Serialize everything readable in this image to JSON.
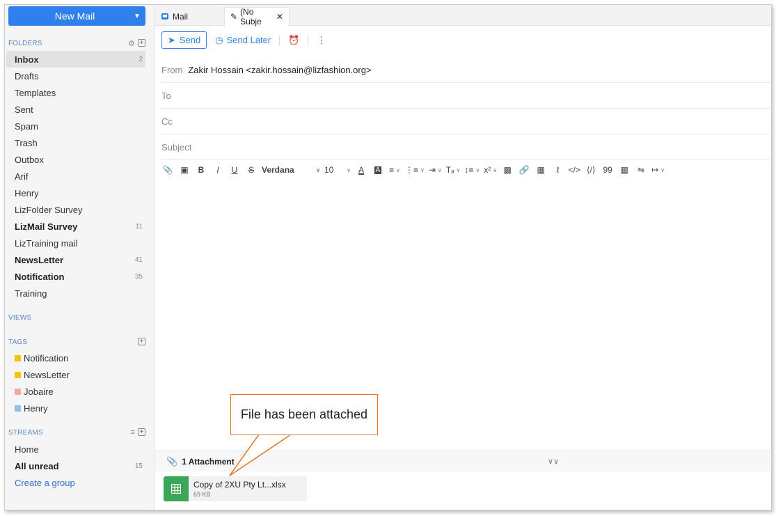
{
  "sidebar": {
    "new_mail_label": "New Mail",
    "folders_heading": "FOLDERS",
    "folders": [
      {
        "label": "Inbox",
        "count": "2"
      },
      {
        "label": "Drafts",
        "count": ""
      },
      {
        "label": "Templates",
        "count": ""
      },
      {
        "label": "Sent",
        "count": ""
      },
      {
        "label": "Spam",
        "count": ""
      },
      {
        "label": "Trash",
        "count": ""
      },
      {
        "label": "Outbox",
        "count": ""
      },
      {
        "label": "Arif",
        "count": ""
      },
      {
        "label": "Henry",
        "count": ""
      },
      {
        "label": "LizFolder Survey",
        "count": ""
      },
      {
        "label": "LizMail Survey",
        "count": "11"
      },
      {
        "label": "LizTraining mail",
        "count": ""
      },
      {
        "label": "NewsLetter",
        "count": "41"
      },
      {
        "label": "Notification",
        "count": "35"
      },
      {
        "label": "Training",
        "count": ""
      }
    ],
    "views_heading": "VIEWS",
    "tags_heading": "TAGS",
    "tags": [
      {
        "label": "Notification",
        "color": "#f2c500"
      },
      {
        "label": "NewsLetter",
        "color": "#f2c500"
      },
      {
        "label": "Jobaire",
        "color": "#f0a9a0"
      },
      {
        "label": "Henry",
        "color": "#8fc1ea"
      }
    ],
    "streams_heading": "STREAMS",
    "streams": [
      {
        "label": "Home",
        "count": ""
      },
      {
        "label": "All unread",
        "count": "15"
      }
    ],
    "create_group_label": "Create a group"
  },
  "tabs": [
    {
      "label": "Mail"
    },
    {
      "label": "(No Subje"
    }
  ],
  "actions": {
    "send_label": "Send",
    "send_later_label": "Send Later"
  },
  "compose": {
    "from_label": "From",
    "from_value": "Zakir Hossain <zakir.hossain@lizfashion.org>",
    "to_label": "To",
    "cc_label": "Cc",
    "subject_placeholder": "Subject"
  },
  "editor_toolbar": {
    "font": "Verdana",
    "size": "10"
  },
  "attachments": {
    "title": "1 Attachment",
    "file_name": "Copy of 2XU Pty Lt...xlsx",
    "file_size": "69 KB"
  },
  "callout": {
    "text": "File has been attached"
  },
  "colors": {
    "accent": "#2f80ed",
    "callout_border": "#e37222",
    "xlsx_icon": "#3aa757"
  }
}
